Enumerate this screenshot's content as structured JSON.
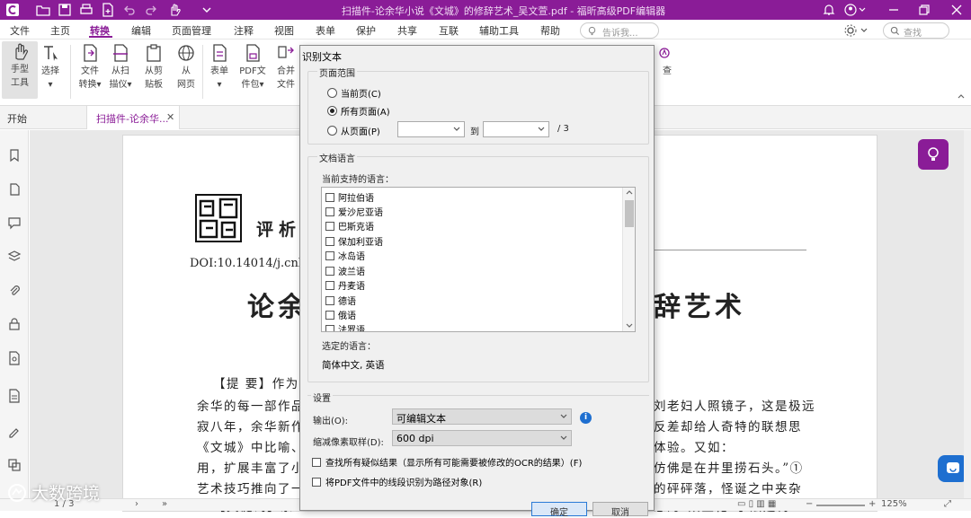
{
  "titlebar": {
    "title": "扫描件-论余华小说《文城》的修辞艺术_吴文萱.pdf - 福昕高级PDF编辑器",
    "accent": "#8a1c97"
  },
  "menu": {
    "items": [
      "文件",
      "主页",
      "转换",
      "编辑",
      "页面管理",
      "注释",
      "视图",
      "表单",
      "保护",
      "共享",
      "互联",
      "辅助工具",
      "帮助"
    ],
    "active": "转换",
    "tell_placeholder": "告诉我...",
    "search_placeholder": "查找"
  },
  "ribbon": {
    "hand_l1": "手型",
    "hand_l2": "工具",
    "select_l1": "选择",
    "select_l2": "▾",
    "fileconv_l1": "文件",
    "fileconv_l2": "转换▾",
    "scan_l1": "从扫",
    "scan_l2": "描仪▾",
    "clip_l1": "从剪",
    "clip_l2": "贴板",
    "web_l1": "从",
    "web_l2": "网页",
    "form_l1": "表单",
    "form_l2": "▾",
    "pkg_l1": "PDF文",
    "pkg_l2": "件包▾",
    "merge_l1": "合并",
    "merge_l2": "文件",
    "right_l1": "",
    "right_l2": "查"
  },
  "tabs": {
    "start": "开始",
    "doc": "扫描件-论余华...",
    "close": "✕"
  },
  "document": {
    "header_word": "评析",
    "doi": "DOI:10.14014/j.cnki.cn",
    "title_left": "论余",
    "title_right": "辞艺术",
    "lines_left": [
      "【提 要】作为",
      "余华的每一部作品",
      "寂八年，余华新作",
      "《文城》中比喻、",
      "用，扩展丰富了小",
      "艺术技巧推向了一",
      "【关键词】余"
    ],
    "lines_right": [
      "刘老妇人照镜子，这是极远",
      "反差却给人奇特的联想思",
      "体验。又如：",
      "仿佛是在井里捞石头。”①",
      "的砰砰落，怪诞之中夹杂",
      "想的“陌生化”手法建构"
    ]
  },
  "statusbar": {
    "page": "1 / 3",
    "zoom": "125%"
  },
  "dialog": {
    "title": "识别文本",
    "page_range": {
      "label": "页面范围",
      "current": "当前页(C)",
      "all": "所有页面(A)",
      "from": "从页面(P)",
      "to": "到",
      "total": "/ 3",
      "selected": "all"
    },
    "language": {
      "label": "文档语言",
      "supported_label": "当前支持的语言：",
      "options": [
        "阿拉伯语",
        "爱沙尼亚语",
        "巴斯克语",
        "保加利亚语",
        "冰岛语",
        "波兰语",
        "丹麦语",
        "德语",
        "俄语",
        "法罗语"
      ],
      "selected_label": "选定的语言：",
      "selected_value": "简体中文, 英语"
    },
    "settings": {
      "label": "设置",
      "output_label": "输出(O):",
      "output_value": "可编辑文本",
      "downsample_label": "缩减像素取样(D):",
      "downsample_value": "600 dpi",
      "check_suspect": "查找所有疑似结果（显示所有可能需要被修改的OCR的结果）(F)",
      "check_lines": "将PDF文件中的线段识别为路径对象(R)"
    },
    "ok": "确定",
    "cancel": "取消"
  },
  "watermark": "大数跨境"
}
